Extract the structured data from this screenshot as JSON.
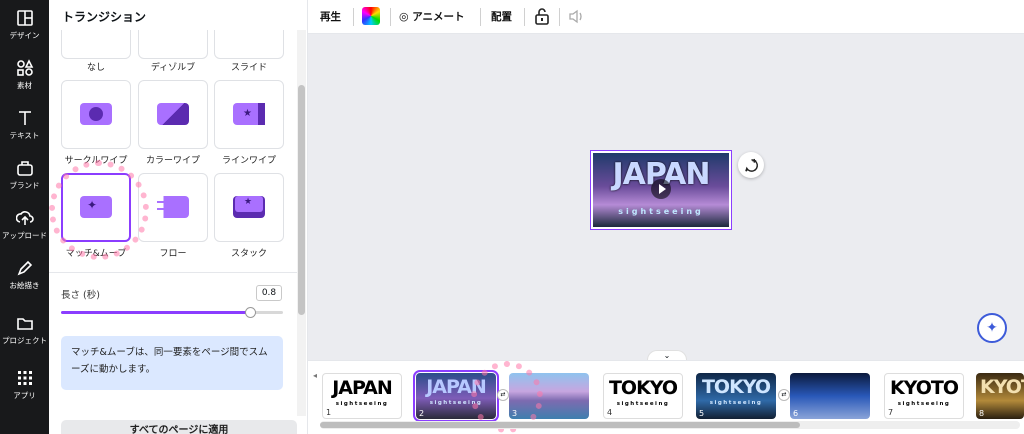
{
  "rail": [
    {
      "label": "デザイン",
      "icon": "layout-icon"
    },
    {
      "label": "素材",
      "icon": "shapes-icon"
    },
    {
      "label": "テキスト",
      "icon": "text-icon"
    },
    {
      "label": "ブランド",
      "icon": "brand-icon"
    },
    {
      "label": "アップロード",
      "icon": "cloud-upload-icon"
    },
    {
      "label": "お絵描き",
      "icon": "pen-icon"
    },
    {
      "label": "プロジェクト",
      "icon": "folder-icon"
    },
    {
      "label": "アプリ",
      "icon": "grid-icon"
    }
  ],
  "panel": {
    "title": "トランジション",
    "tiles": [
      "なし",
      "ディゾルブ",
      "スライド",
      "サークルワイプ",
      "カラーワイプ",
      "ラインワイプ",
      "マッチ&ムーブ",
      "フロー",
      "スタック"
    ],
    "selected": "マッチ&ムーブ",
    "duration_label": "長さ (秒)",
    "duration_value": "0.8",
    "duration_fraction": 0.8,
    "info": "マッチ&ムーブは、同一要素をページ間でスムーズに動かします。",
    "apply_button": "すべてのページに適用"
  },
  "toolbar": {
    "play": "再生",
    "animate": "アニメート",
    "position": "配置"
  },
  "canvas": {
    "slide_title": "JAPAN",
    "slide_subtitle": "sightseeing"
  },
  "timeline": {
    "pages": [
      {
        "num": "1",
        "title": "JAPAN",
        "sub": "sightseeing",
        "style": "white"
      },
      {
        "num": "2",
        "title": "JAPAN",
        "sub": "sightseeing",
        "style": "photo-purple"
      },
      {
        "num": "3",
        "title": "",
        "sub": "",
        "style": "photo-sakura"
      },
      {
        "num": "4",
        "title": "TOKYO",
        "sub": "sightseeing",
        "style": "white"
      },
      {
        "num": "5",
        "title": "TOKYO",
        "sub": "sightseeing",
        "style": "photo-blue"
      },
      {
        "num": "6",
        "title": "",
        "sub": "",
        "style": "photo-city"
      },
      {
        "num": "7",
        "title": "KYOTO",
        "sub": "sightseeing",
        "style": "white"
      },
      {
        "num": "8",
        "title": "KYOTO",
        "sub": "",
        "style": "photo-gold"
      }
    ],
    "selected_page": "2"
  },
  "colors": {
    "accent": "#8b3dff",
    "rail": "#18191b",
    "canvas_bg": "#ebecf0",
    "info_bg": "#dbe8ff"
  }
}
